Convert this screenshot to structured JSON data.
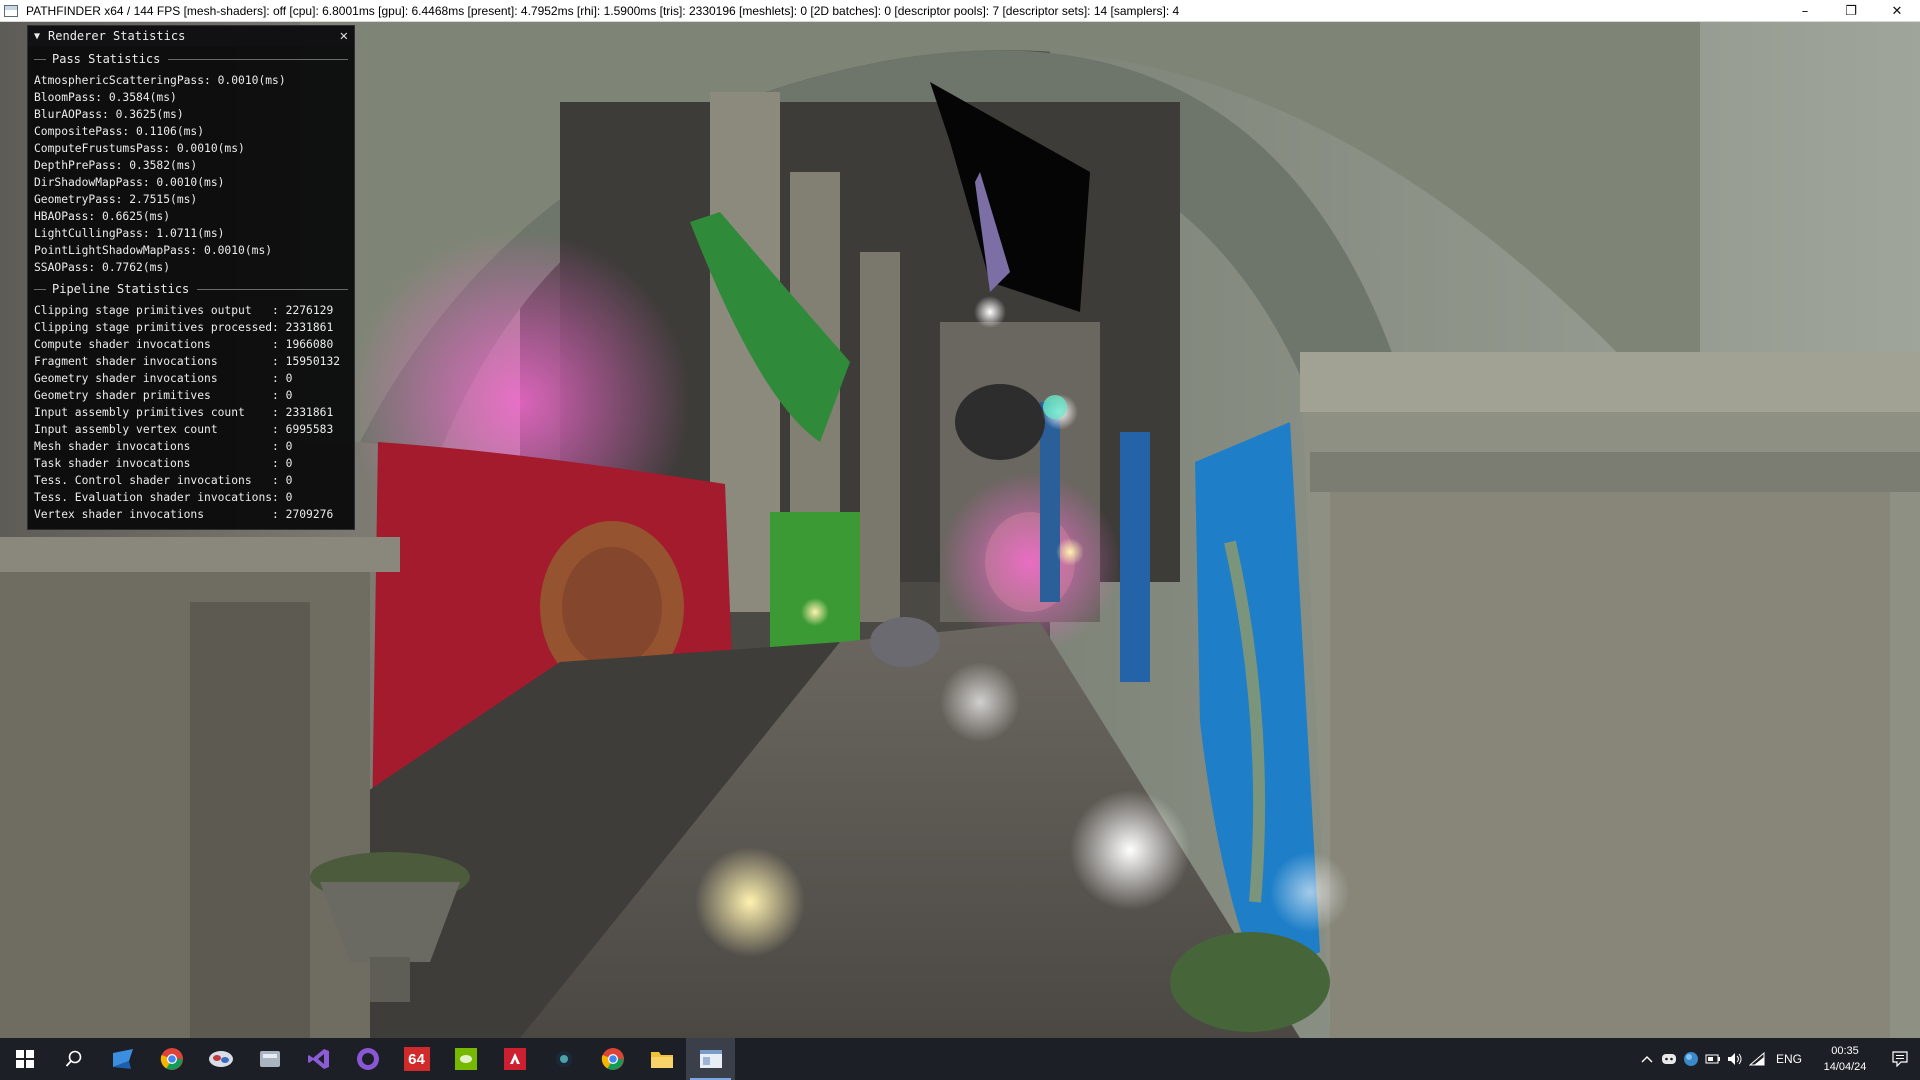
{
  "window": {
    "title": "PATHFINDER x64 / 144 FPS [mesh-shaders]: off [cpu]: 6.8001ms [gpu]: 6.4468ms [present]: 4.7952ms [rhi]: 1.5900ms  [tris]: 2330196 [meshlets]: 0 [2D batches]: 0 [descriptor pools]: 7 [descriptor sets]: 14 [samplers]: 4",
    "minimize": "–",
    "restore": "❐",
    "close": "✕"
  },
  "panel": {
    "title": "Renderer Statistics",
    "close": "✕",
    "pass_section": "Pass Statistics",
    "pass_rows": [
      "AtmosphericScatteringPass: 0.0010(ms)",
      "BloomPass: 0.3584(ms)",
      "BlurAOPass: 0.3625(ms)",
      "CompositePass: 0.1106(ms)",
      "ComputeFrustumsPass: 0.0010(ms)",
      "DepthPrePass: 0.3582(ms)",
      "DirShadowMapPass: 0.0010(ms)",
      "GeometryPass: 2.7515(ms)",
      "HBAOPass: 0.6625(ms)",
      "LightCullingPass: 1.0711(ms)",
      "PointLightShadowMapPass: 0.0010(ms)",
      "SSAOPass: 0.7762(ms)"
    ],
    "pipeline_section": "Pipeline Statistics",
    "pipeline_rows": [
      "Clipping stage primitives output   : 2276129",
      "Clipping stage primitives processed: 2331861",
      "Compute shader invocations         : 1966080",
      "Fragment shader invocations        : 15950132",
      "Geometry shader invocations        : 0",
      "Geometry shader primitives         : 0",
      "Input assembly primitives count    : 2331861",
      "Input assembly vertex count        : 6995583",
      "Mesh shader invocations            : 0",
      "Task shader invocations            : 0",
      "Tess. Control shader invocations   : 0",
      "Tess. Evaluation shader invocations: 0",
      "Vertex shader invocations          : 2709276"
    ]
  },
  "taskbar": {
    "apps": [
      "start",
      "search",
      "cortana-arrow",
      "chrome",
      "app-bird",
      "file-manager-app",
      "visual-studio",
      "github-desktop",
      "aida64",
      "nvidia",
      "amd",
      "steam",
      "chrome-2",
      "file-explorer",
      "pathfinder-app"
    ],
    "aida_label": "64",
    "language": "ENG",
    "time": "00:35",
    "date": "14/04/24"
  },
  "colors": {
    "curtain_red": "#a31b2c",
    "curtain_green": "#2f8a3a",
    "curtain_blue": "#1e7fc8",
    "stone": "#8c8a80",
    "taskbar": "#1c1f26",
    "accent": "#7aa7e6"
  }
}
